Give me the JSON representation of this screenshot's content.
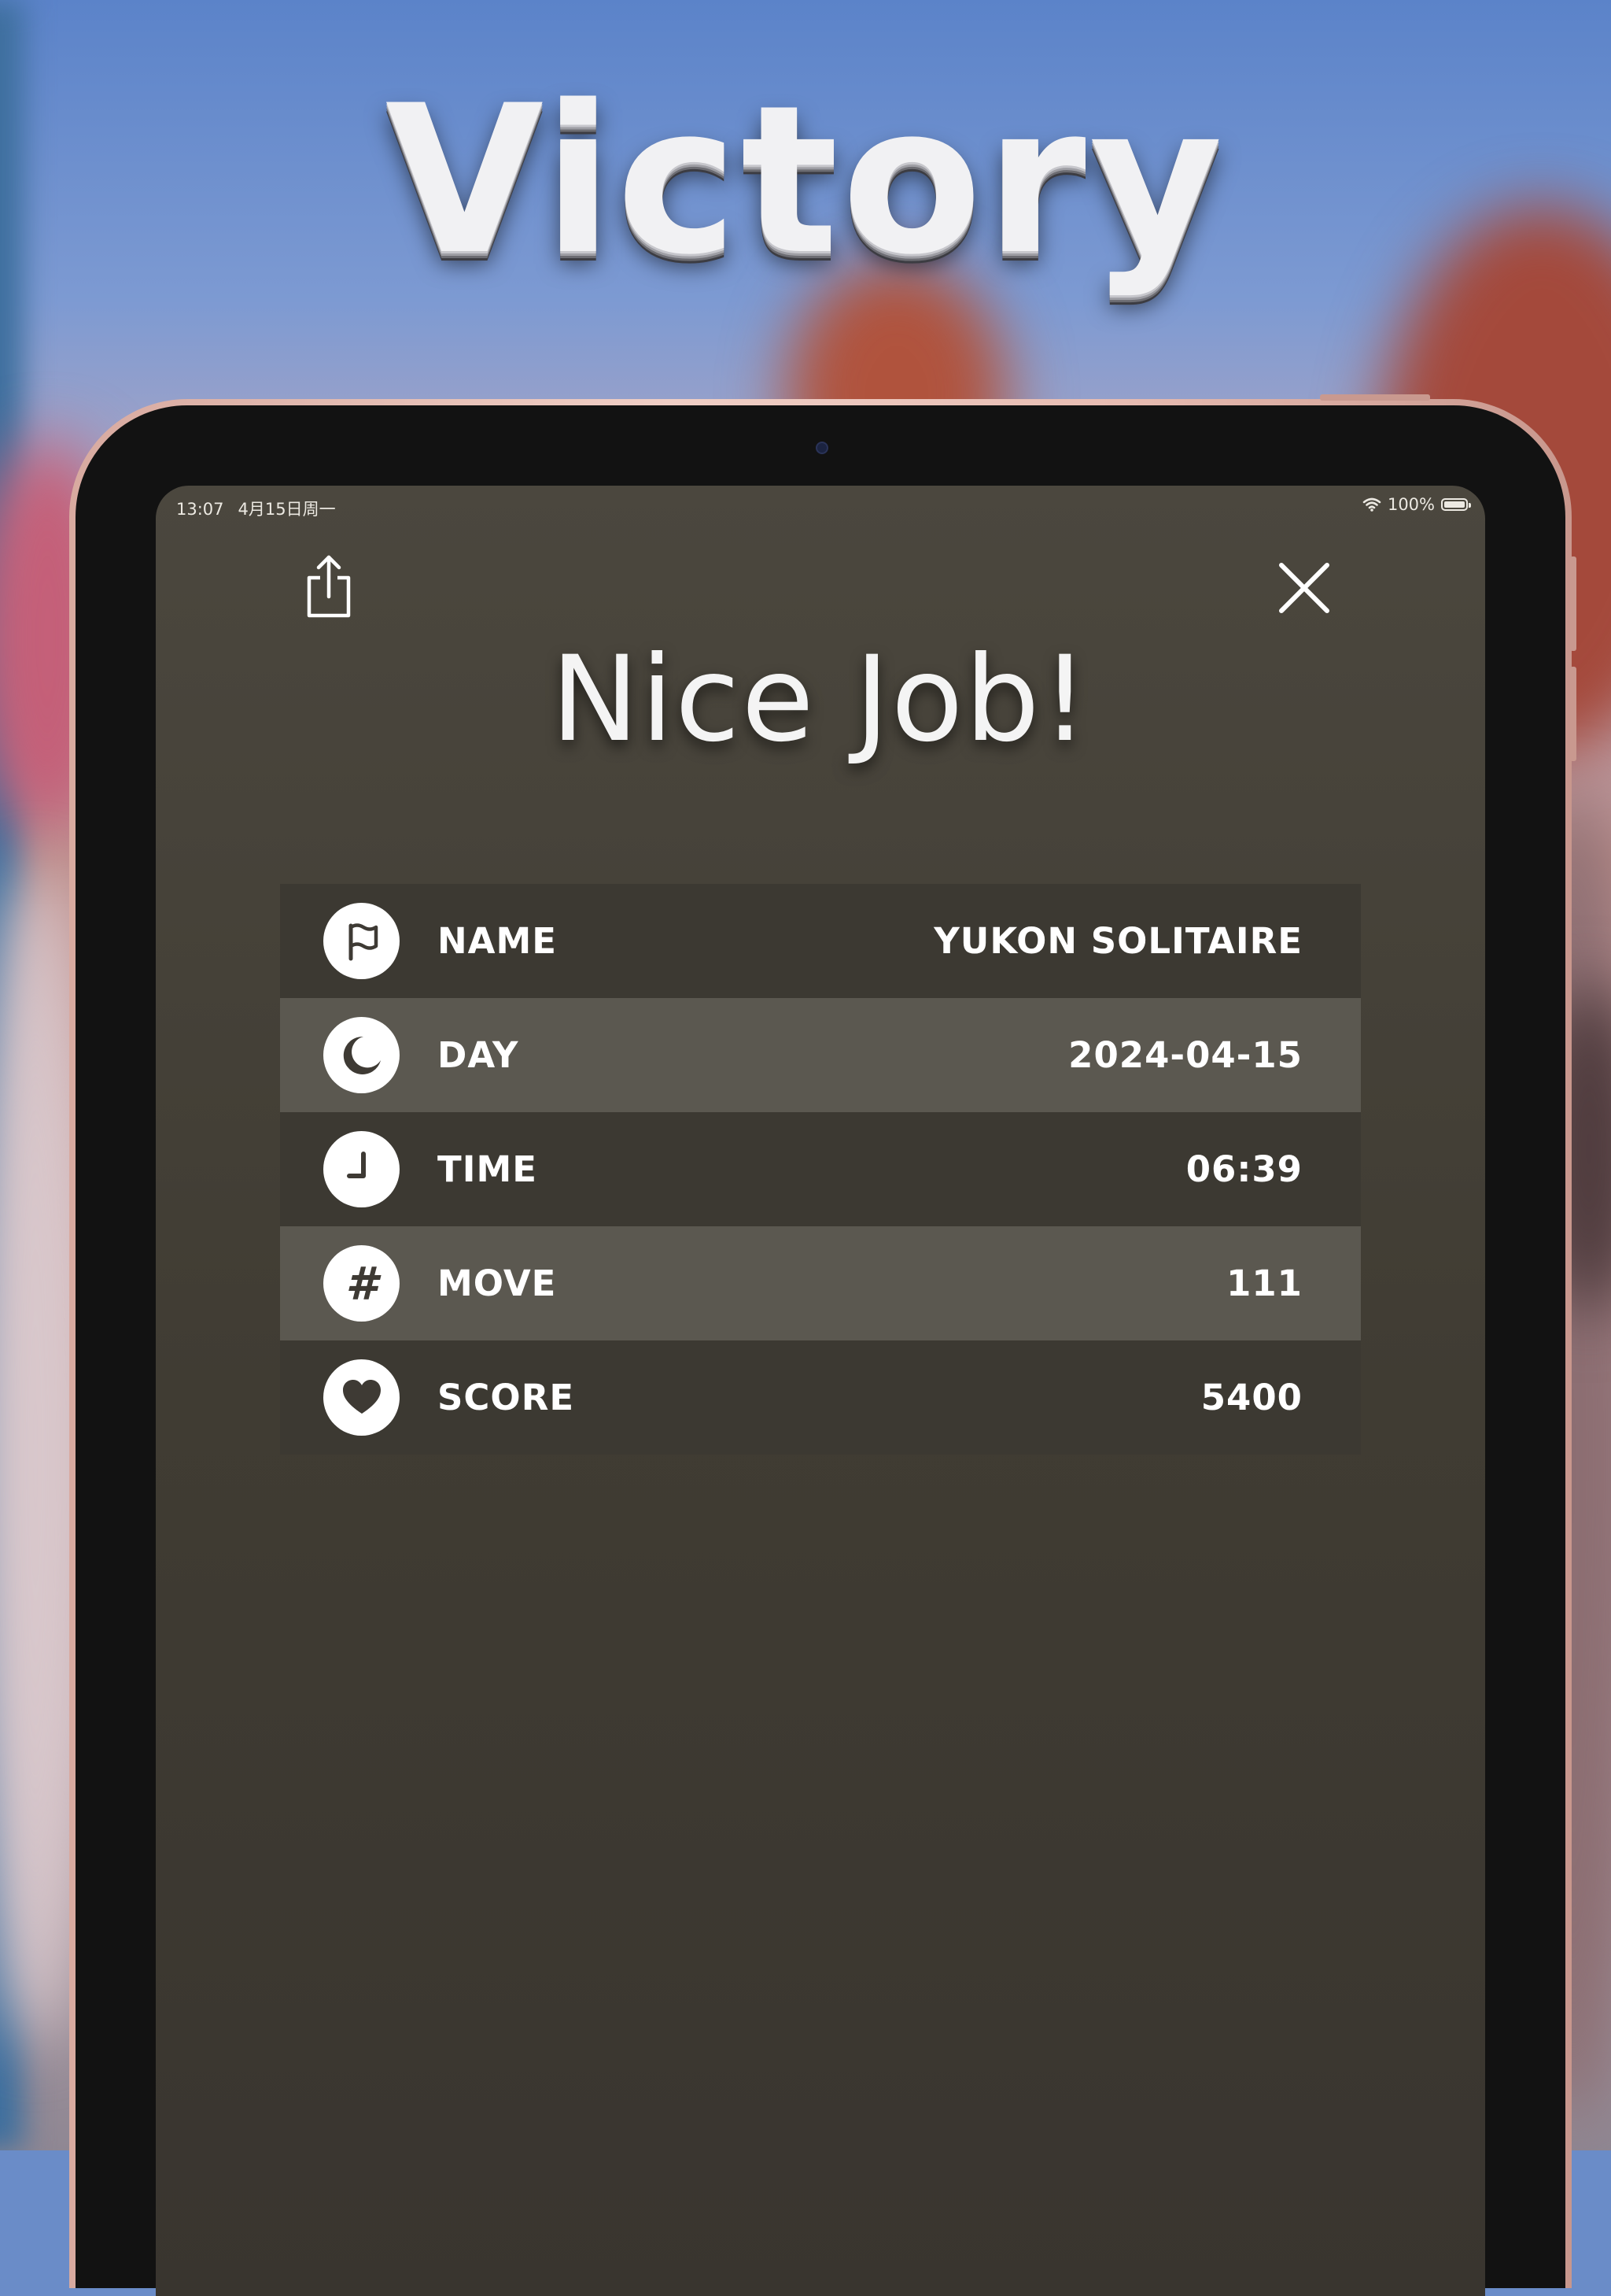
{
  "headline": "Victory",
  "status_bar": {
    "time": "13:07",
    "date": "4月15日周一",
    "battery_pct": "100%"
  },
  "dialog": {
    "title": "Nice Job!",
    "share_icon": "share-icon",
    "close_icon": "close-icon",
    "rows": [
      {
        "icon": "flag-icon",
        "label": "NAME",
        "value": "YUKON SOLITAIRE"
      },
      {
        "icon": "moon-icon",
        "label": "DAY",
        "value": "2024-04-15"
      },
      {
        "icon": "clock-icon",
        "label": "TIME",
        "value": "06:39"
      },
      {
        "icon": "hash-icon",
        "label": "MOVE",
        "value": "111",
        "glyph": "#"
      },
      {
        "icon": "heart-icon",
        "label": "SCORE",
        "value": "5400"
      }
    ]
  },
  "colors": {
    "screen_bg": "#46423a",
    "row_dark": "#3c3932",
    "row_light": "#5b5850",
    "text": "#ffffff",
    "icon_fg": "#3e3a34"
  }
}
